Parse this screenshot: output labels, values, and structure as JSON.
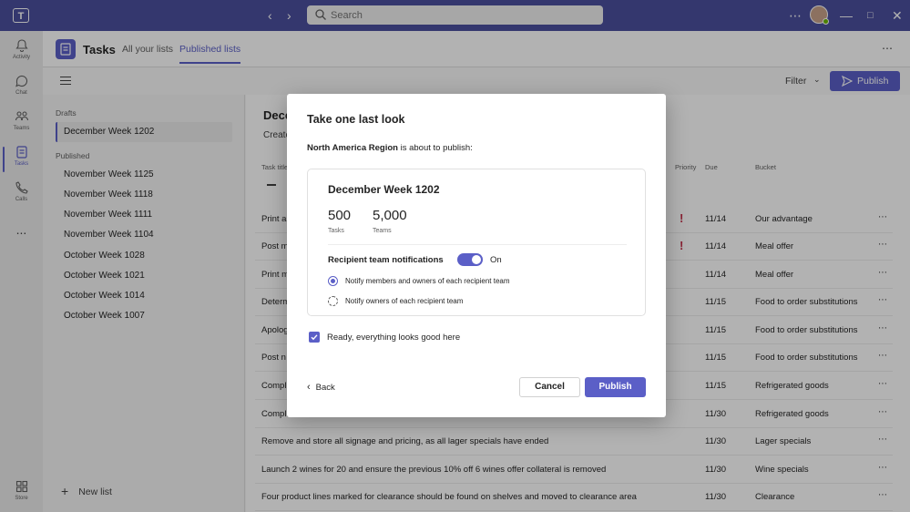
{
  "titlebar": {
    "logo_text": "T",
    "search_placeholder": "Search",
    "more_icon": "more-icon",
    "window_controls": [
      "minimize",
      "restore",
      "close"
    ]
  },
  "rail": [
    {
      "label": "Activity",
      "icon": "bell-icon"
    },
    {
      "label": "Chat",
      "icon": "chat-icon"
    },
    {
      "label": "Teams",
      "icon": "teams-icon"
    },
    {
      "label": "Tasks",
      "icon": "tasks-icon",
      "active": true
    },
    {
      "label": "Calls",
      "icon": "phone-icon"
    },
    {
      "label": "...",
      "icon": "more-apps-icon"
    },
    {
      "label": "Store",
      "icon": "store-icon"
    }
  ],
  "appbar": {
    "app_name": "Tasks",
    "tabs": [
      {
        "label": "All your lists",
        "active": false
      },
      {
        "label": "Published lists",
        "active": true
      }
    ]
  },
  "toolbar": {
    "filter_label": "Filter",
    "publish_label": "Publish"
  },
  "sidebar": {
    "drafts_header": "Drafts",
    "drafts": [
      "December Week 1202"
    ],
    "published_header": "Published",
    "published": [
      "November Week 1125",
      "November Week 1118",
      "November Week 1111",
      "November Week 1104",
      "October Week 1028",
      "October Week 1021",
      "October Week 1014",
      "October Week 1007"
    ],
    "new_list_label": "New list"
  },
  "main": {
    "title": "Dece",
    "subtitle": "Create",
    "columns": {
      "task": "Task title",
      "priority": "Priority",
      "due": "Due",
      "bucket": "Bucket"
    },
    "rows": [
      {
        "name": "Print a",
        "priority": "!",
        "due": "11/14",
        "bucket": "Our advantage"
      },
      {
        "name": "Post m",
        "priority": "!",
        "due": "11/14",
        "bucket": "Meal offer"
      },
      {
        "name": "Print m",
        "priority": "",
        "due": "11/14",
        "bucket": "Meal offer"
      },
      {
        "name": "Determ",
        "priority": "",
        "due": "11/15",
        "bucket": "Food to order substitutions"
      },
      {
        "name": "Apolog",
        "priority": "",
        "due": "11/15",
        "bucket": "Food to order substitutions"
      },
      {
        "name": "Post n",
        "priority": "",
        "due": "11/15",
        "bucket": "Food to order substitutions"
      },
      {
        "name": "Compl",
        "priority": "",
        "due": "11/15",
        "bucket": "Refrigerated goods"
      },
      {
        "name": "Compl",
        "priority": "",
        "due": "11/30",
        "bucket": "Refrigerated goods"
      },
      {
        "name": "Remove and store all signage and pricing, as all lager specials have ended",
        "priority": "",
        "due": "11/30",
        "bucket": "Lager specials"
      },
      {
        "name": "Launch 2 wines for 20 and ensure the previous 10% off 6 wines offer collateral is removed",
        "priority": "",
        "due": "11/30",
        "bucket": "Wine specials"
      },
      {
        "name": "Four product lines marked for clearance should be found on shelves and moved to clearance area",
        "priority": "",
        "due": "11/30",
        "bucket": "Clearance"
      }
    ]
  },
  "dialog": {
    "title": "Take one last look",
    "publisher": "North America Region",
    "publish_text": " is about to publish:",
    "card_title": "December Week 1202",
    "tasks_count": "500",
    "tasks_label": "Tasks",
    "teams_count": "5,000",
    "teams_label": "Teams",
    "notifications_label": "Recipient team notifications",
    "notifications_state": "On",
    "option_members": "Notify members and owners of each recipient team",
    "option_owners": "Notify owners of each recipient team",
    "ready_label": "Ready, everything looks good here",
    "back_label": "Back",
    "cancel_label": "Cancel",
    "publish_label": "Publish"
  },
  "colors": {
    "titlebar": "#4b4f9e",
    "accent": "#5b5fc7",
    "priority": "#c4314b"
  }
}
